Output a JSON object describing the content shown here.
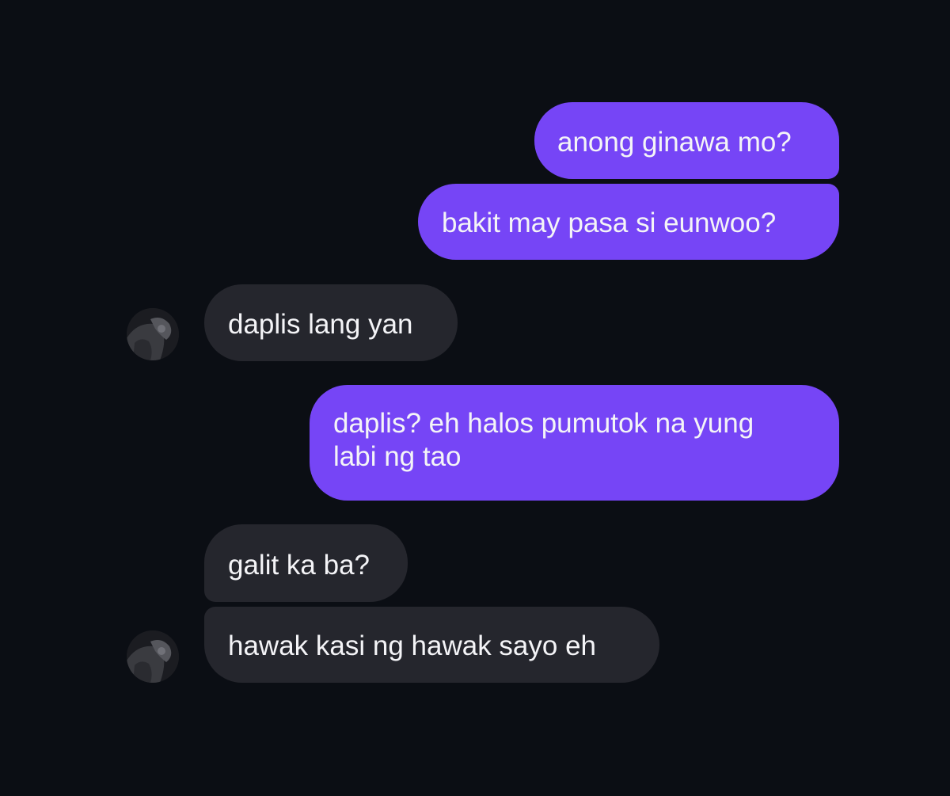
{
  "messages": [
    {
      "id": "m1",
      "direction": "sent",
      "text": "anong ginawa mo?"
    },
    {
      "id": "m2",
      "direction": "sent",
      "text": "bakit may pasa si eunwoo?"
    },
    {
      "id": "m3",
      "direction": "received",
      "text": "daplis lang yan",
      "show_avatar": true
    },
    {
      "id": "m4",
      "direction": "sent",
      "lines": [
        "daplis? eh halos pumutok na yung",
        "labi ng tao"
      ]
    },
    {
      "id": "m5",
      "direction": "received",
      "text": "galit ka ba?"
    },
    {
      "id": "m6",
      "direction": "received",
      "text": "hawak kasi ng hawak sayo eh",
      "show_avatar": true
    }
  ],
  "colors": {
    "background": "#0b0e14",
    "sent_bubble": "#7645f6",
    "received_bubble": "#25262d",
    "text": "#f4f4f7"
  },
  "icons": {
    "avatar": "contact-avatar-photo"
  }
}
